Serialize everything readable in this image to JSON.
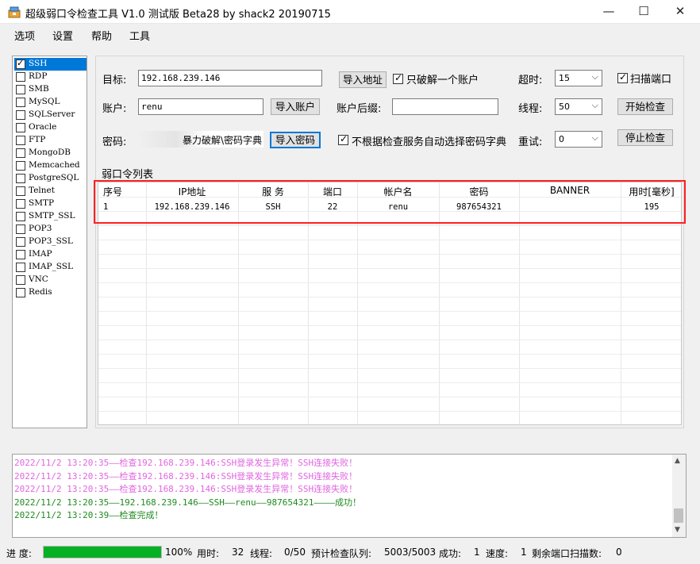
{
  "window": {
    "title": "超级弱口令检查工具 V1.0 测试版 Beta28 by shack2 20190715",
    "minimize_glyph": "—",
    "maximize_glyph": "☐",
    "close_glyph": "✕"
  },
  "menu": [
    "选项",
    "设置",
    "帮助",
    "工具"
  ],
  "services": [
    {
      "label": "SSH",
      "checked": true,
      "selected": true
    },
    {
      "label": "RDP",
      "checked": false
    },
    {
      "label": "SMB",
      "checked": false
    },
    {
      "label": "MySQL",
      "checked": false
    },
    {
      "label": "SQLServer",
      "checked": false
    },
    {
      "label": "Oracle",
      "checked": false
    },
    {
      "label": "FTP",
      "checked": false
    },
    {
      "label": "MongoDB",
      "checked": false
    },
    {
      "label": "Memcached",
      "checked": false
    },
    {
      "label": "PostgreSQL",
      "checked": false
    },
    {
      "label": "Telnet",
      "checked": false
    },
    {
      "label": "SMTP",
      "checked": false
    },
    {
      "label": "SMTP_SSL",
      "checked": false
    },
    {
      "label": "POP3",
      "checked": false
    },
    {
      "label": "POP3_SSL",
      "checked": false
    },
    {
      "label": "IMAP",
      "checked": false
    },
    {
      "label": "IMAP_SSL",
      "checked": false
    },
    {
      "label": "VNC",
      "checked": false
    },
    {
      "label": "Redis",
      "checked": false
    }
  ],
  "config": {
    "target_label": "目标:",
    "target_value": "192.168.239.146",
    "import_address": "导入地址",
    "crack_one_label": "只破解一个账户",
    "crack_one_checked": true,
    "account_label": "账户:",
    "account_value": "renu",
    "import_account": "导入账户",
    "suffix_label": "账户后缀:",
    "suffix_value": "",
    "password_label": "密码:",
    "password_value": "暴力破解\\密码字典",
    "import_password": "导入密码",
    "auto_dict_label": "不根据检查服务自动选择密码字典",
    "auto_dict_checked": true,
    "timeout_label": "超时:",
    "timeout_value": "15",
    "threads_label": "线程:",
    "threads_value": "50",
    "retry_label": "重试:",
    "retry_value": "0",
    "scan_port_label": "扫描端口",
    "scan_port_checked": true,
    "start_button": "开始检查",
    "stop_button": "停止检查"
  },
  "results": {
    "group_title": "弱口令列表",
    "columns": [
      "序号",
      "IP地址",
      "服 务",
      "端口",
      "帐户名",
      "密码",
      "BANNER",
      "用时[毫秒]"
    ],
    "rows": [
      [
        "1",
        "192.168.239.146",
        "SSH",
        "22",
        "renu",
        "987654321",
        "",
        "195"
      ]
    ]
  },
  "log": [
    {
      "text": "2022/11/2 13:20:35——检查192.168.239.146:SSH登录发生异常！SSH连接失败！",
      "type": "err"
    },
    {
      "text": "2022/11/2 13:20:35——检查192.168.239.146:SSH登录发生异常！SSH连接失败！",
      "type": "err"
    },
    {
      "text": "2022/11/2 13:20:35——检查192.168.239.146:SSH登录发生异常！SSH连接失败！",
      "type": "err"
    },
    {
      "text": "2022/11/2 13:20:35——192.168.239.146——SSH——renu——987654321————成功！",
      "type": "ok"
    },
    {
      "text": "2022/11/2 13:20:39——检查完成！",
      "type": "ok"
    }
  ],
  "status": {
    "progress_label": "进 度:",
    "progress_percent": 100,
    "progress_text": "100%",
    "elapsed_label": "用时:",
    "elapsed_value": "32",
    "threads_label": "线程:",
    "threads_value": "0/50",
    "queue_label": "预计检查队列:",
    "queue_value": "5003/5003",
    "success_label": "成功:",
    "success_value": "1",
    "speed_label": "速度:",
    "speed_value": "1",
    "remaining_label": "剩余端口扫描数:",
    "remaining_value": "0"
  },
  "colors": {
    "accent": "#0078d7",
    "progress": "#06b025",
    "highlight": "#ff2020",
    "log_error": "#e066e0",
    "log_ok": "#1f8a1f"
  }
}
